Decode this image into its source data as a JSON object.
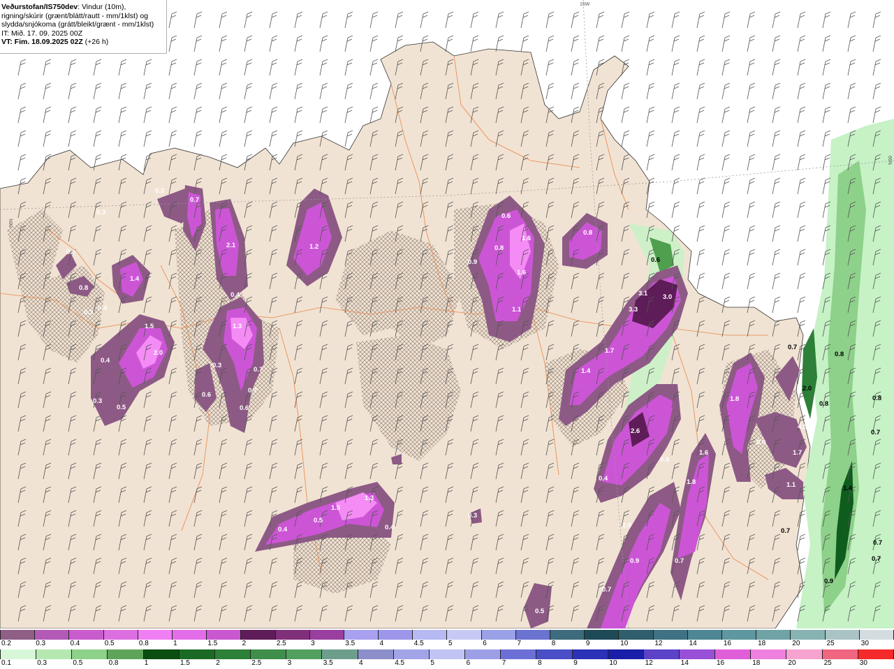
{
  "title": {
    "brand": "Veðurstofan/IS750dev",
    "line1_rest": ": Vindur (10m),",
    "line2": "rigning/skúrir (grænt/blátt/rautt - mm/1klst) og",
    "line3": "slydda/snjókoma (grátt/bleikt/grænt - mm/1klst)",
    "line4": "IT: Mið. 17. 09. 2025 00Z",
    "line5_bold": "VT: Fim. 18.09.2025 02Z",
    "line5_rest": " (+26 h)"
  },
  "grid_labels": {
    "top": "15W",
    "left": "66N",
    "right": "66N"
  },
  "colors": {
    "sea": "#ffffff",
    "land": "#f1e3d3",
    "roads": "#e8925a",
    "snow_light": "#8d5a85",
    "snow_mid": "#cc55d6",
    "snow_high": "#f58cf5",
    "rain_light": "#c6f2c6",
    "rain_mid": "#4f9f4f",
    "rain_high": "#0e5d1e"
  },
  "map_values": [
    {
      "text": "0.3",
      "dark": false
    },
    {
      "text": "0.7",
      "dark": false
    },
    {
      "text": "0.3",
      "dark": false
    },
    {
      "text": "2.1",
      "dark": false
    },
    {
      "text": "1.2",
      "dark": false
    },
    {
      "text": "0.6",
      "dark": false
    },
    {
      "text": "1.6",
      "dark": false
    },
    {
      "text": "0.8",
      "dark": false
    },
    {
      "text": "0.8",
      "dark": false
    },
    {
      "text": "0.9",
      "dark": false
    },
    {
      "text": "1.6",
      "dark": false
    },
    {
      "text": "0.3",
      "dark": false
    },
    {
      "text": "1.4",
      "dark": false
    },
    {
      "text": "0.8",
      "dark": false
    },
    {
      "text": "0.4",
      "dark": false
    },
    {
      "text": "0.3",
      "dark": false
    },
    {
      "text": "0.4",
      "dark": false
    },
    {
      "text": "1.1",
      "dark": false
    },
    {
      "text": "1.3",
      "dark": false
    },
    {
      "text": "1.5",
      "dark": false
    },
    {
      "text": "2.0",
      "dark": false
    },
    {
      "text": "0.4",
      "dark": false
    },
    {
      "text": "0.3",
      "dark": false
    },
    {
      "text": "0.7",
      "dark": false
    },
    {
      "text": "0.6",
      "dark": false
    },
    {
      "text": "0.7",
      "dark": false
    },
    {
      "text": "0.6",
      "dark": false
    },
    {
      "text": "0.3",
      "dark": false
    },
    {
      "text": "0.5",
      "dark": false
    },
    {
      "text": "0.6",
      "dark": true
    },
    {
      "text": "3.1",
      "dark": false
    },
    {
      "text": "3.0",
      "dark": false
    },
    {
      "text": "3.3",
      "dark": false
    },
    {
      "text": "1.7",
      "dark": false
    },
    {
      "text": "1.4",
      "dark": false
    },
    {
      "text": "2.6",
      "dark": false
    },
    {
      "text": "0.4",
      "dark": false
    },
    {
      "text": "1.6",
      "dark": false
    },
    {
      "text": "1.8",
      "dark": false
    },
    {
      "text": "2.0",
      "dark": false
    },
    {
      "text": "0.9",
      "dark": false
    },
    {
      "text": "0.7",
      "dark": false
    },
    {
      "text": "0.7",
      "dark": false
    },
    {
      "text": "0.5",
      "dark": false
    },
    {
      "text": "0.4",
      "dark": false
    },
    {
      "text": "0.5",
      "dark": false
    },
    {
      "text": "1.5",
      "dark": false
    },
    {
      "text": "1.3",
      "dark": false
    },
    {
      "text": "0.4",
      "dark": false
    },
    {
      "text": "0.3",
      "dark": false
    },
    {
      "text": "1.8",
      "dark": false
    },
    {
      "text": "0.7",
      "dark": true
    },
    {
      "text": "0.8",
      "dark": true
    },
    {
      "text": "2.0",
      "dark": true
    },
    {
      "text": "0.8",
      "dark": true
    },
    {
      "text": "0.8",
      "dark": true
    },
    {
      "text": "0.7",
      "dark": true
    },
    {
      "text": "1.4",
      "dark": true
    },
    {
      "text": "0.7",
      "dark": true
    },
    {
      "text": "0.7",
      "dark": true
    },
    {
      "text": "0.9",
      "dark": true
    },
    {
      "text": "0.7",
      "dark": true
    },
    {
      "text": "4.5",
      "dark": false
    },
    {
      "text": "1.1",
      "dark": false
    },
    {
      "text": "1.7",
      "dark": false
    },
    {
      "text": "0.9",
      "dark": false
    },
    {
      "text": "0.5",
      "dark": false
    }
  ],
  "legend_snow": {
    "labels": [
      "0.2",
      "0.3",
      "0.4",
      "0.5",
      "0.8",
      "1",
      "1.5",
      "2",
      "2.5",
      "3",
      "3.5",
      "4",
      "4.5",
      "5",
      "6",
      "7",
      "8",
      "9",
      "10",
      "12",
      "14",
      "16",
      "18",
      "20",
      "25",
      "30"
    ],
    "colors": [
      "#8f5f86",
      "#b25ab6",
      "#c95ccd",
      "#dc6fe0",
      "#f07ff4",
      "#e36de8",
      "#c957cf",
      "#5e1c58",
      "#80307a",
      "#9a3fa0",
      "#aaa0f0",
      "#9c97ea",
      "#b7b9f2",
      "#c7c9f5",
      "#9aa1e6",
      "#6a73cf",
      "#3e6b7d",
      "#1e4a58",
      "#2f5e6c",
      "#3f7284",
      "#4e8694",
      "#5e979f",
      "#6fa3a6",
      "#87b3b3",
      "#aac3c5",
      "#d3dde0"
    ]
  },
  "legend_rain": {
    "labels": [
      "0.1",
      "0.3",
      "0.5",
      "0.8",
      "1",
      "1.5",
      "2",
      "2.5",
      "3",
      "3.5",
      "4",
      "4.5",
      "5",
      "6",
      "7",
      "8",
      "9",
      "10",
      "12",
      "14",
      "16",
      "18",
      "20",
      "25",
      "30"
    ],
    "colors": [
      "#d8f7d8",
      "#b5e8b0",
      "#8ed18a",
      "#5ea55a",
      "#0b4e12",
      "#1a6a25",
      "#2d8038",
      "#3f8f4b",
      "#52a060",
      "#6d9e8c",
      "#8c8fc9",
      "#a2a4e8",
      "#c2c4f4",
      "#9c9fe6",
      "#6c70d6",
      "#4a4fc8",
      "#2c31b8",
      "#1a1ea8",
      "#5b42c8",
      "#9a4fd8",
      "#e05ed8",
      "#f080e0",
      "#f6a3d0",
      "#f06580",
      "#f52a2a"
    ]
  }
}
